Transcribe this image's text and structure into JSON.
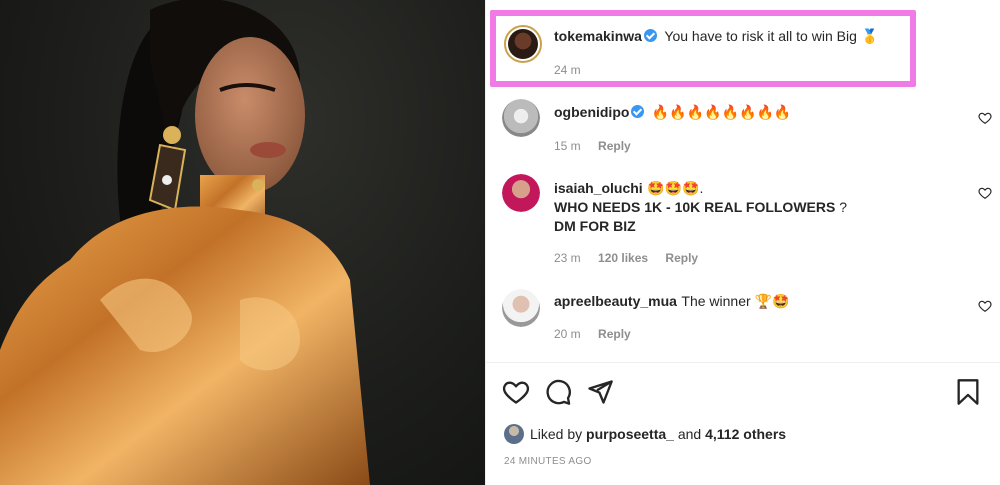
{
  "caption": {
    "username": "tokemakinwa",
    "text": "You have to risk it all to win Big",
    "emoji": "🥇",
    "time": "24 m"
  },
  "comments": [
    {
      "username": "ogbenidipo",
      "verified": true,
      "text": "🔥🔥🔥🔥🔥🔥🔥🔥",
      "time": "15 m",
      "likes": "",
      "reply": "Reply"
    },
    {
      "username": "isaiah_oluchi",
      "verified": false,
      "text_line1": "🤩🤩🤩.",
      "text_line2_pre": "WHO NEEDS 1K - 10K ",
      "text_line2_bold": "REAL FOLLOWERS",
      "text_line2_post": " ?",
      "text_line3": "DM FOR BIZ",
      "time": "23 m",
      "likes": "120 likes",
      "reply": "Reply"
    },
    {
      "username": "apreelbeauty_mua",
      "verified": false,
      "text": "The winner 🏆🤩",
      "time": "20 m",
      "likes": "",
      "reply": "Reply"
    }
  ],
  "likes": {
    "prefix": "Liked by",
    "user": "purposeetta_",
    "and": "and",
    "count": "4,112 others"
  },
  "posted": "24 MINUTES AGO",
  "colors": {
    "highlight": "#f07ae6",
    "verified": "#3897f0"
  },
  "icons": [
    "heart-icon",
    "comment-icon",
    "share-icon",
    "bookmark-icon"
  ]
}
